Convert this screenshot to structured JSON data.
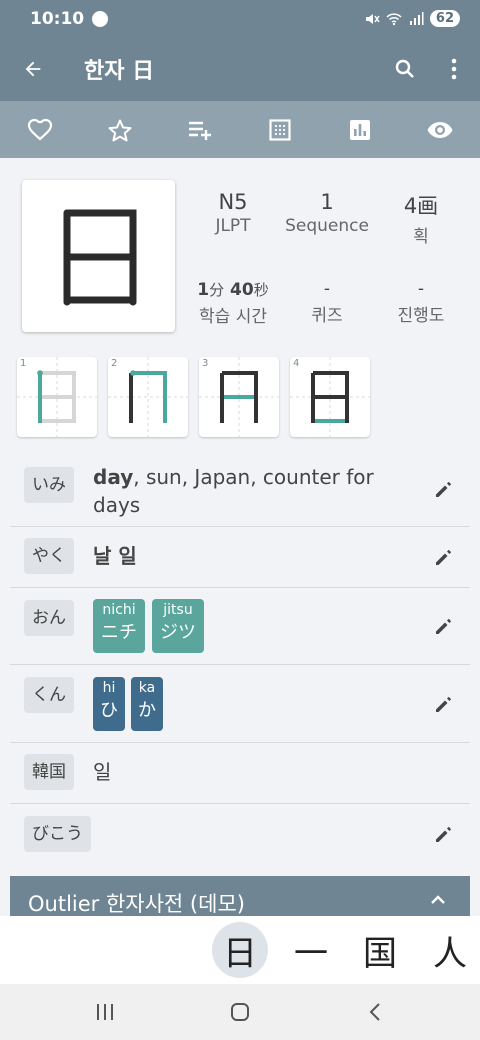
{
  "status_bar": {
    "time": "10:10",
    "battery": "62"
  },
  "app_bar": {
    "title": "한자 日"
  },
  "kanji": {
    "character": "日"
  },
  "stats": {
    "jlpt_value": "N5",
    "jlpt_label": "JLPT",
    "sequence_value": "1",
    "sequence_label": "Sequence",
    "strokes_value": "4画",
    "strokes_label": "획",
    "study_time": {
      "min_num": "1",
      "min_unit": "分",
      "sec_num": "40",
      "sec_unit": "秒"
    },
    "study_time_label": "학습 시간",
    "quiz_value": "-",
    "quiz_label": "퀴즈",
    "progress_value": "-",
    "progress_label": "진행도"
  },
  "stroke_numbers": [
    "1",
    "2",
    "3",
    "4"
  ],
  "meaning": {
    "label": "いみ",
    "bold": "day",
    "rest": ", sun, Japan, counter for",
    "rest2": "days"
  },
  "yaku": {
    "label": "やく",
    "value": "날 일"
  },
  "on": {
    "label": "おん",
    "readings": [
      {
        "romaji": "nichi",
        "kana": "ニチ"
      },
      {
        "romaji": "jitsu",
        "kana": "ジツ"
      }
    ]
  },
  "kun": {
    "label": "くん",
    "readings": [
      {
        "romaji": "hi",
        "kana": "ひ"
      },
      {
        "romaji": "ka",
        "kana": "か"
      }
    ]
  },
  "korean": {
    "label": "韓国",
    "value": "일"
  },
  "bikou": {
    "label": "びこう"
  },
  "outlier": {
    "title": "Outlier 한자사전 (데모)"
  },
  "related_kanji": [
    "日",
    "一",
    "国",
    "人"
  ],
  "colors": {
    "header": "#6f8593",
    "toolbar": "#8fa2ae",
    "on_reading": "#5aa69c",
    "kun_reading": "#3f6c8c",
    "stroke_highlight": "#4aa89c"
  }
}
